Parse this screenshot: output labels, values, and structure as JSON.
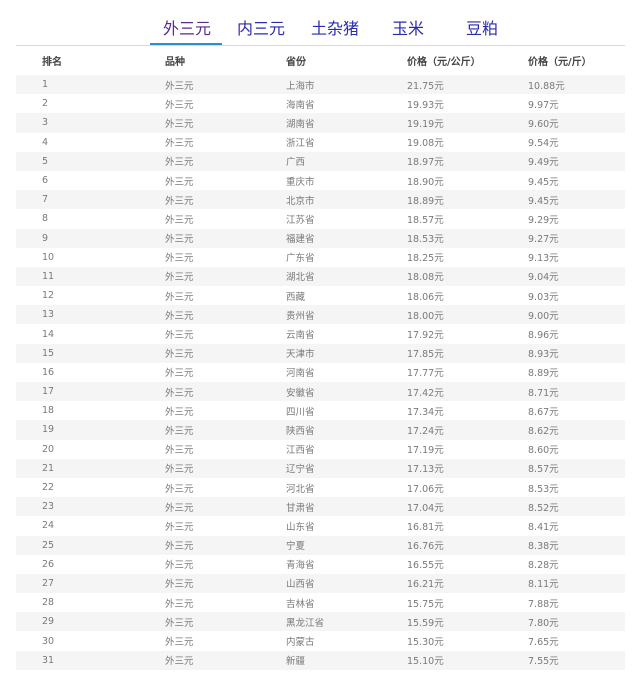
{
  "tabs": [
    {
      "label": "外三元",
      "active": true
    },
    {
      "label": "内三元",
      "active": false
    },
    {
      "label": "土杂猪",
      "active": false
    },
    {
      "label": "玉米",
      "active": false
    },
    {
      "label": "豆粕",
      "active": false
    }
  ],
  "colors": {
    "tab_text": "#2a2ab0",
    "tab_active": "#5a2a8f",
    "tab_underline": "#2b8fd6",
    "row_stripe": "#f5f5f5"
  },
  "table": {
    "headers": [
      "排名",
      "品种",
      "省份",
      "价格（元/公斤）",
      "价格（元/斤）"
    ],
    "rows": [
      [
        "1",
        "外三元",
        "上海市",
        "21.75元",
        "10.88元"
      ],
      [
        "2",
        "外三元",
        "海南省",
        "19.93元",
        "9.97元"
      ],
      [
        "3",
        "外三元",
        "湖南省",
        "19.19元",
        "9.60元"
      ],
      [
        "4",
        "外三元",
        "浙江省",
        "19.08元",
        "9.54元"
      ],
      [
        "5",
        "外三元",
        "广西",
        "18.97元",
        "9.49元"
      ],
      [
        "6",
        "外三元",
        "重庆市",
        "18.90元",
        "9.45元"
      ],
      [
        "7",
        "外三元",
        "北京市",
        "18.89元",
        "9.45元"
      ],
      [
        "8",
        "外三元",
        "江苏省",
        "18.57元",
        "9.29元"
      ],
      [
        "9",
        "外三元",
        "福建省",
        "18.53元",
        "9.27元"
      ],
      [
        "10",
        "外三元",
        "广东省",
        "18.25元",
        "9.13元"
      ],
      [
        "11",
        "外三元",
        "湖北省",
        "18.08元",
        "9.04元"
      ],
      [
        "12",
        "外三元",
        "西藏",
        "18.06元",
        "9.03元"
      ],
      [
        "13",
        "外三元",
        "贵州省",
        "18.00元",
        "9.00元"
      ],
      [
        "14",
        "外三元",
        "云南省",
        "17.92元",
        "8.96元"
      ],
      [
        "15",
        "外三元",
        "天津市",
        "17.85元",
        "8.93元"
      ],
      [
        "16",
        "外三元",
        "河南省",
        "17.77元",
        "8.89元"
      ],
      [
        "17",
        "外三元",
        "安徽省",
        "17.42元",
        "8.71元"
      ],
      [
        "18",
        "外三元",
        "四川省",
        "17.34元",
        "8.67元"
      ],
      [
        "19",
        "外三元",
        "陕西省",
        "17.24元",
        "8.62元"
      ],
      [
        "20",
        "外三元",
        "江西省",
        "17.19元",
        "8.60元"
      ],
      [
        "21",
        "外三元",
        "辽宁省",
        "17.13元",
        "8.57元"
      ],
      [
        "22",
        "外三元",
        "河北省",
        "17.06元",
        "8.53元"
      ],
      [
        "23",
        "外三元",
        "甘肃省",
        "17.04元",
        "8.52元"
      ],
      [
        "24",
        "外三元",
        "山东省",
        "16.81元",
        "8.41元"
      ],
      [
        "25",
        "外三元",
        "宁夏",
        "16.76元",
        "8.38元"
      ],
      [
        "26",
        "外三元",
        "青海省",
        "16.55元",
        "8.28元"
      ],
      [
        "27",
        "外三元",
        "山西省",
        "16.21元",
        "8.11元"
      ],
      [
        "28",
        "外三元",
        "吉林省",
        "15.75元",
        "7.88元"
      ],
      [
        "29",
        "外三元",
        "黑龙江省",
        "15.59元",
        "7.80元"
      ],
      [
        "30",
        "外三元",
        "内蒙古",
        "15.30元",
        "7.65元"
      ],
      [
        "31",
        "外三元",
        "新疆",
        "15.10元",
        "7.55元"
      ]
    ]
  }
}
